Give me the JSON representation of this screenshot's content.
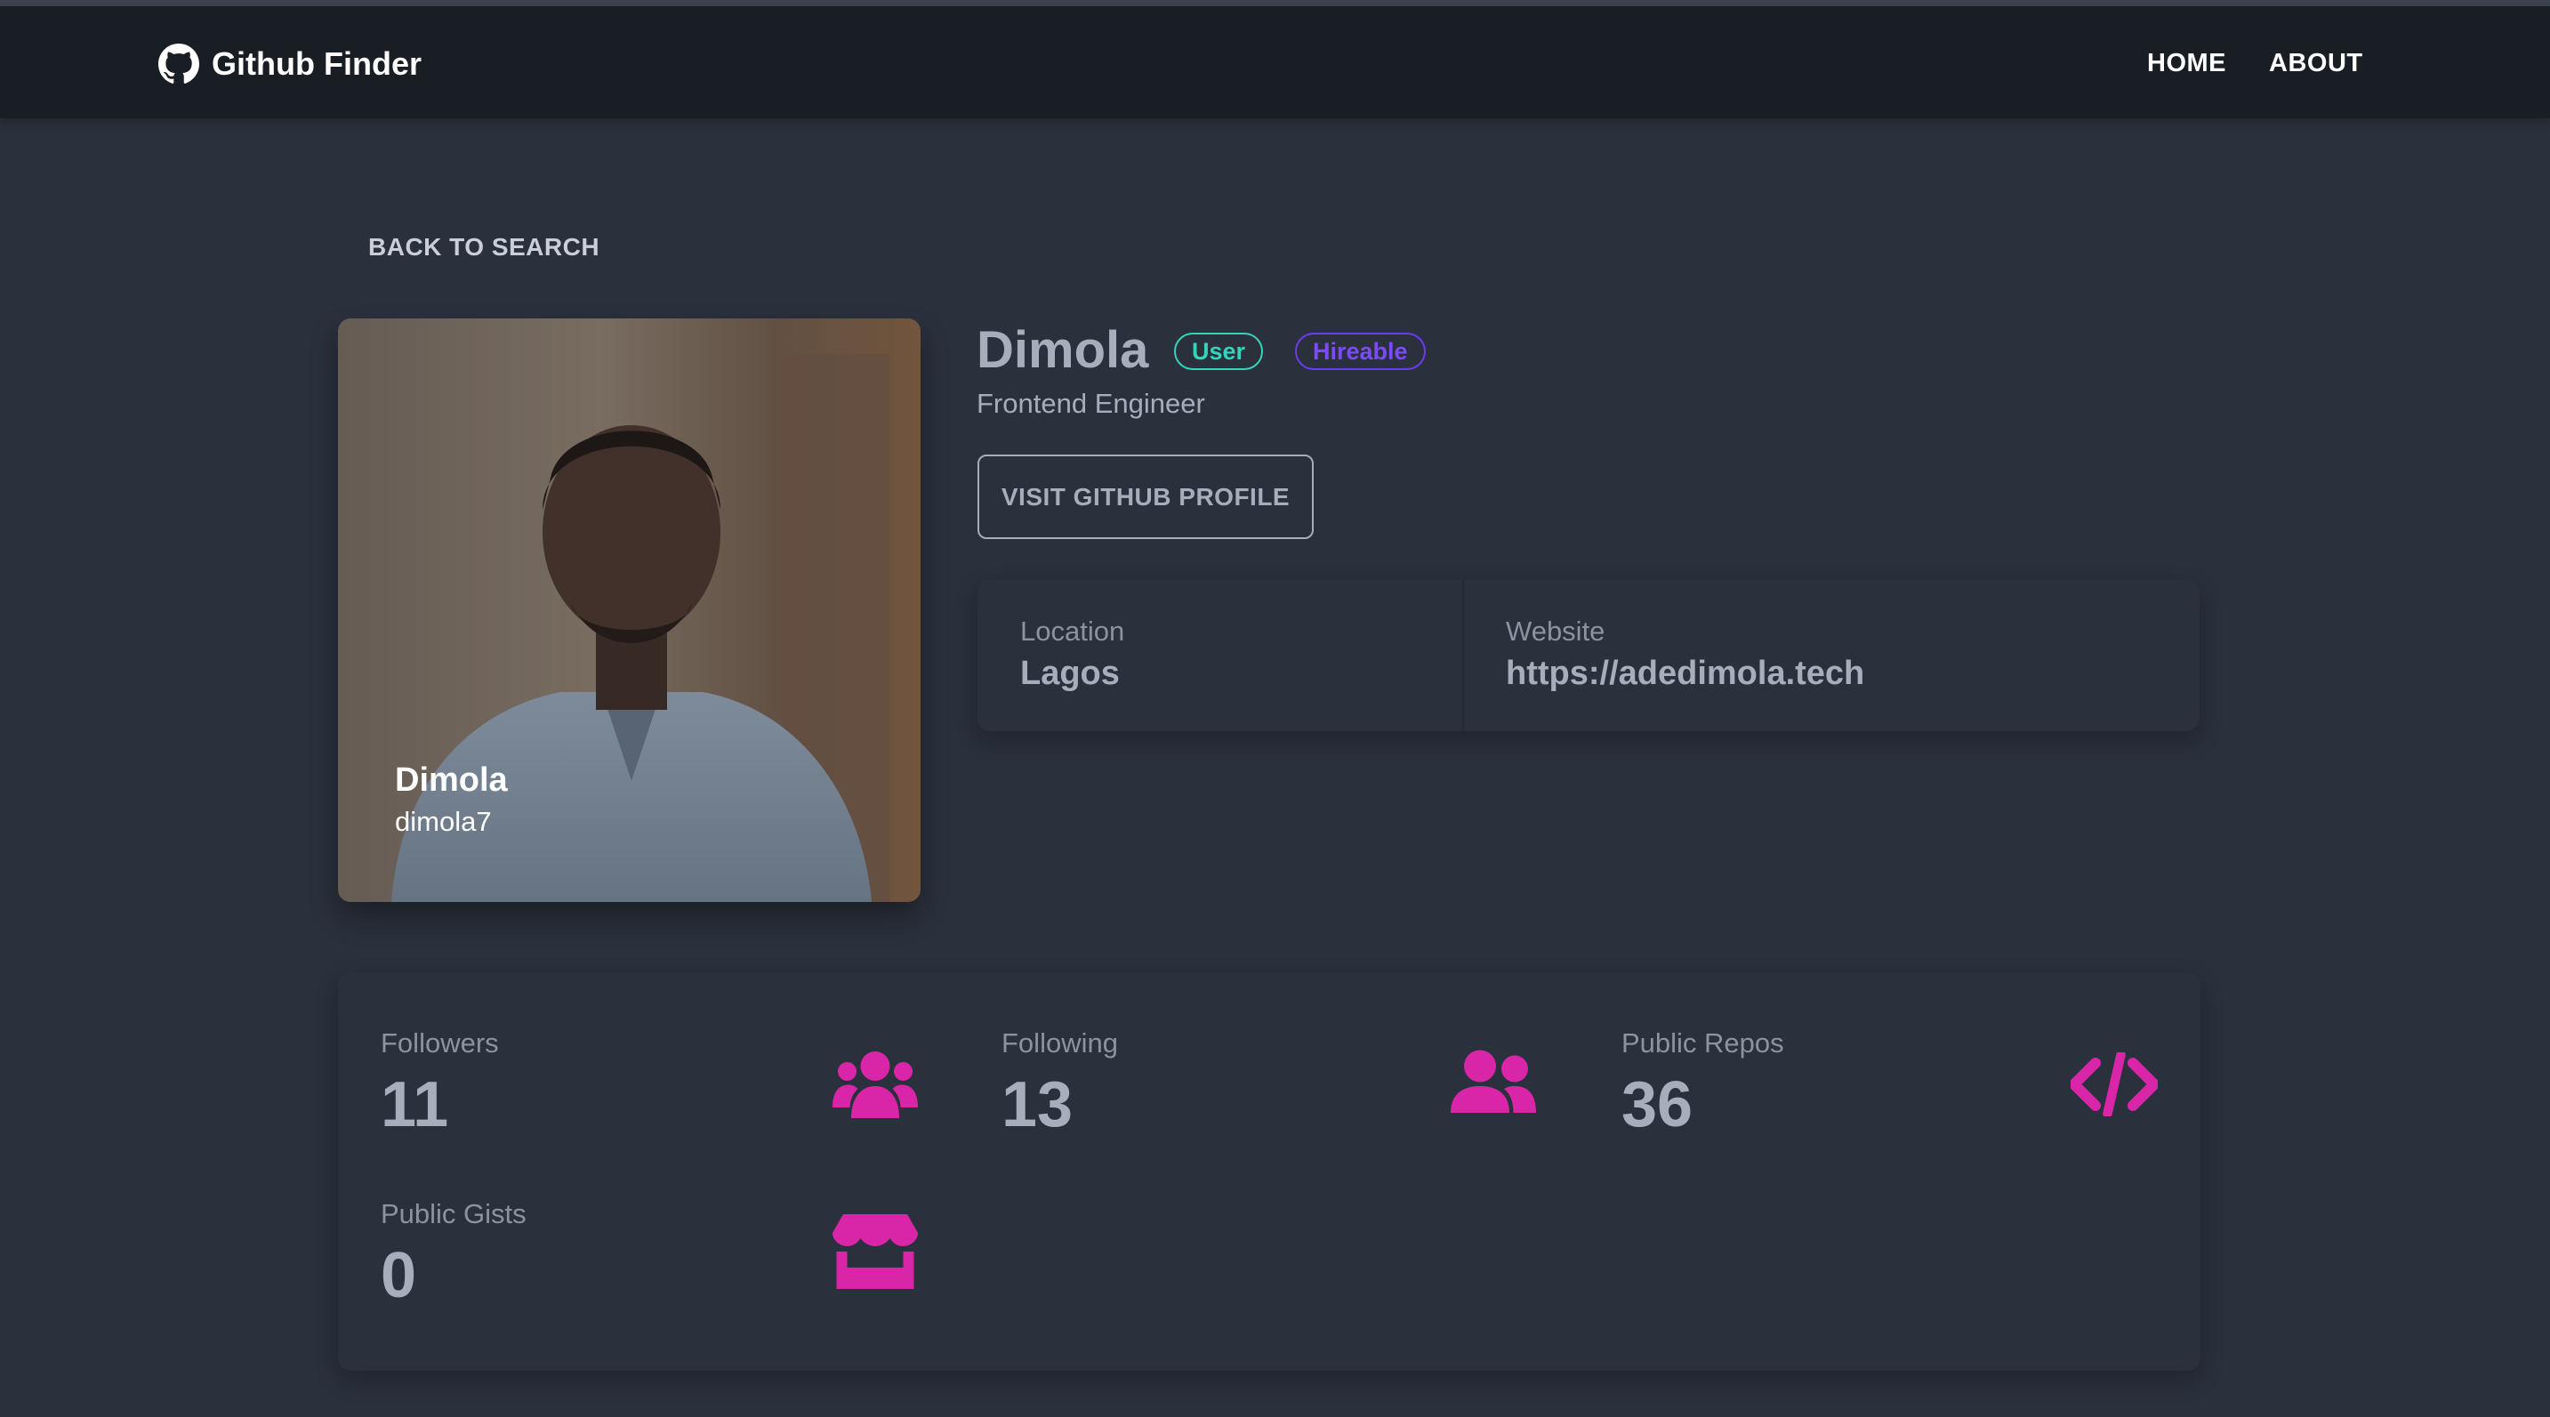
{
  "app": {
    "title": "Github Finder"
  },
  "nav": {
    "home": "HOME",
    "about": "ABOUT"
  },
  "back_label": "BACK TO SEARCH",
  "avatar": {
    "name": "Dimola",
    "login": "dimola7"
  },
  "profile": {
    "name": "Dimola",
    "type_badge": "User",
    "hireable_badge": "Hireable",
    "bio": "Frontend Engineer",
    "visit_button": "VISIT GITHUB PROFILE"
  },
  "info": {
    "location_title": "Location",
    "location_value": "Lagos",
    "website_title": "Website",
    "website_value": "https://adedimola.tech"
  },
  "stats": {
    "followers_title": "Followers",
    "followers": "11",
    "following_title": "Following",
    "following": "13",
    "repos_title": "Public Repos",
    "repos": "36",
    "gists_title": "Public Gists",
    "gists": "0"
  },
  "colors": {
    "accent": "#d926a9",
    "user_badge": "#36d3bb",
    "hireable_badge": "#6d3bef",
    "navbar": "#191d24",
    "background": "#2a303c"
  },
  "icons": {
    "brand": "github-icon",
    "followers": "users-icon",
    "following": "user-friends-icon",
    "repos": "code-icon",
    "gists": "store-icon"
  }
}
